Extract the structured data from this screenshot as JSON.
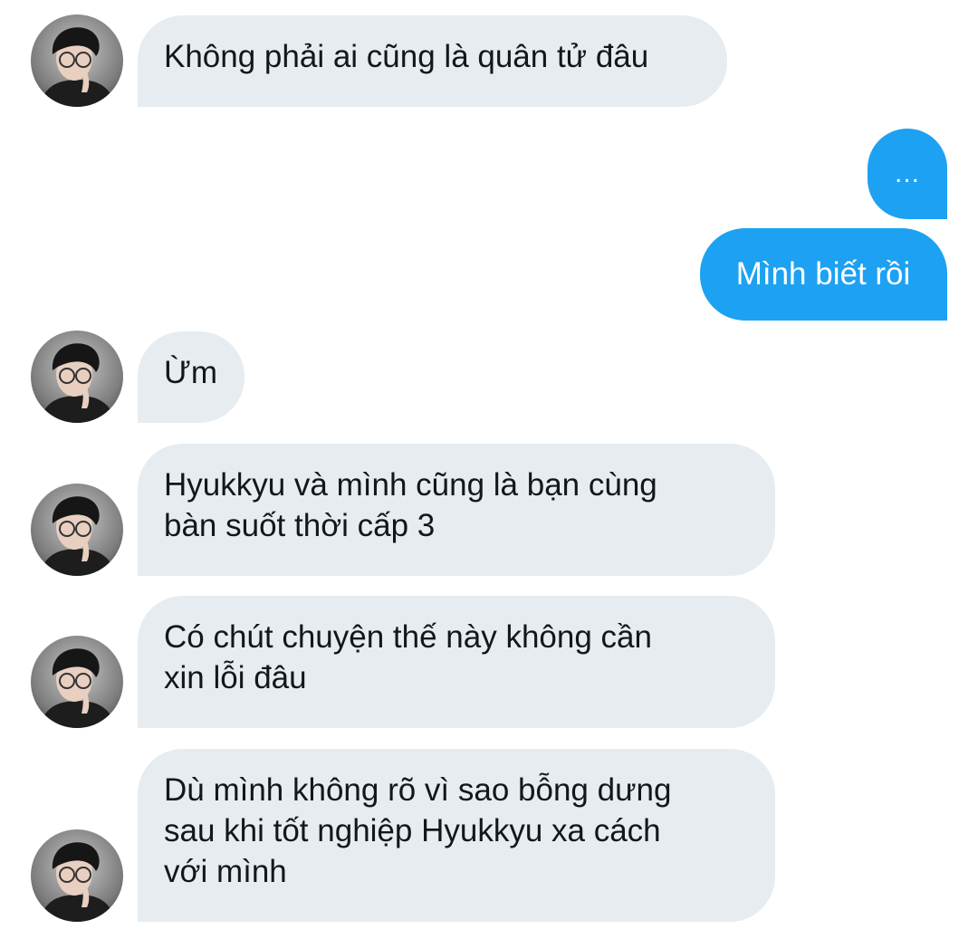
{
  "conversation": {
    "messages": [
      {
        "sender": "other",
        "text": "Không phải ai cũng là quân tử đâu"
      },
      {
        "sender": "me",
        "text": "..."
      },
      {
        "sender": "me",
        "text": "Mình biết rồi"
      },
      {
        "sender": "other",
        "text": "Ừm"
      },
      {
        "sender": "other",
        "text": "Hyukkyu và mình cũng là bạn cùng\nbàn suốt thời cấp 3"
      },
      {
        "sender": "other",
        "text": "Có chút chuyện thế này không cần\nxin lỗi đâu"
      },
      {
        "sender": "other",
        "text": "Dù mình không rõ vì sao bỗng dưng\nsau khi tốt nghiệp Hyukkyu xa cách\nvới mình"
      }
    ]
  },
  "colors": {
    "incoming_bubble": "#e6ecf0",
    "outgoing_bubble": "#1da1f2",
    "incoming_text": "#14171a",
    "outgoing_text": "#ffffff"
  },
  "icons": {
    "avatar": "user-avatar-photo"
  }
}
